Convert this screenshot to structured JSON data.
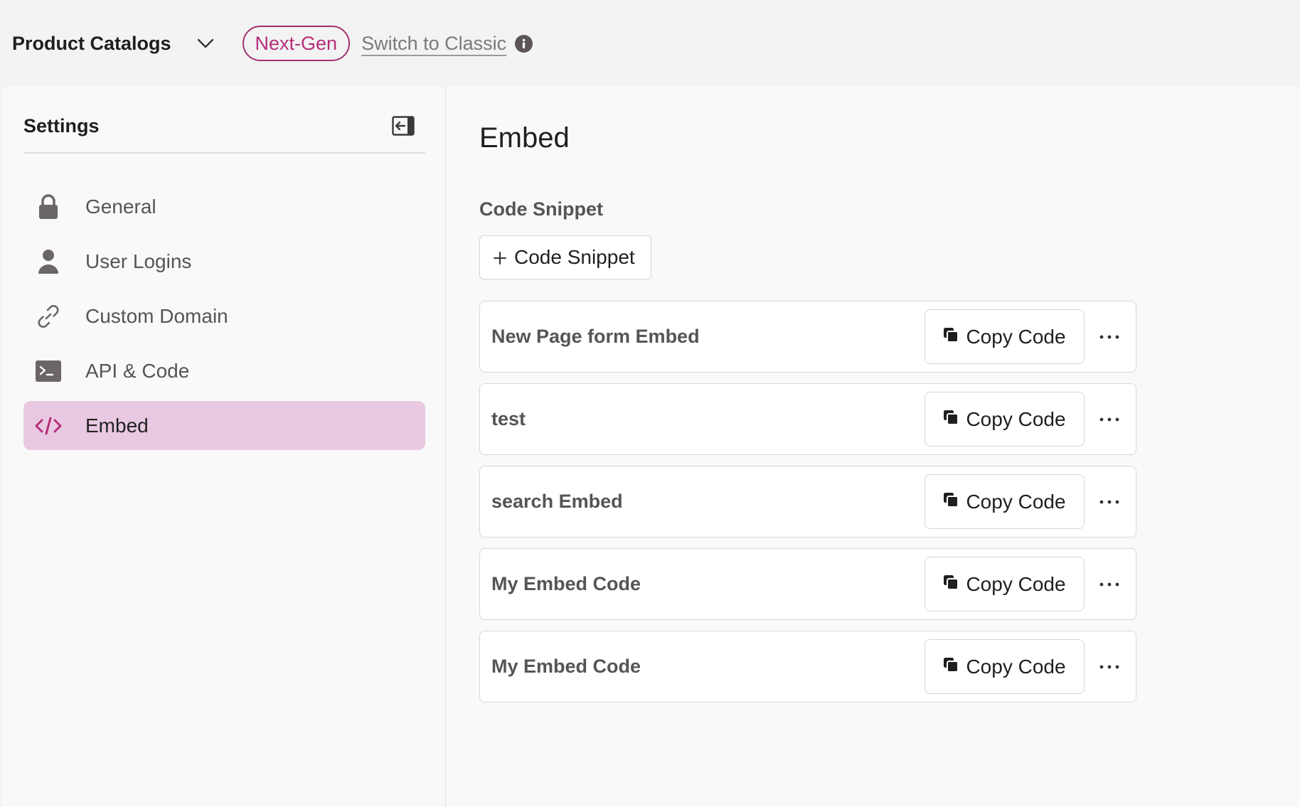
{
  "header": {
    "app_title": "Product Catalogs",
    "badge": "Next-Gen",
    "switch_link": "Switch to Classic"
  },
  "sidebar": {
    "title": "Settings",
    "items": [
      {
        "label": "General",
        "icon": "lock-icon"
      },
      {
        "label": "User Logins",
        "icon": "user-icon"
      },
      {
        "label": "Custom Domain",
        "icon": "link-icon"
      },
      {
        "label": "API & Code",
        "icon": "terminal-icon"
      },
      {
        "label": "Embed",
        "icon": "code-icon",
        "active": true
      }
    ]
  },
  "main": {
    "title": "Embed",
    "section_label": "Code Snippet",
    "add_button_label": "Code Snippet",
    "copy_label": "Copy Code",
    "snippets": [
      {
        "name": "New Page form Embed"
      },
      {
        "name": "test"
      },
      {
        "name": "search Embed"
      },
      {
        "name": "My Embed Code"
      },
      {
        "name": "My Embed Code"
      }
    ]
  },
  "colors": {
    "accent": "#b52e7a",
    "active_bg": "#e9c9e2",
    "icon_gray": "#6b6569"
  }
}
